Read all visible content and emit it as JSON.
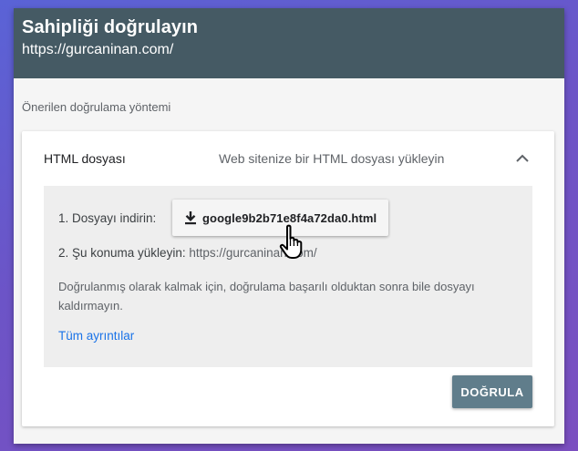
{
  "dialog": {
    "title": "Sahipliği doğrulayın",
    "subtitle": "https://gurcaninan.com/"
  },
  "recommended_label": "Önerilen doğrulama yöntemi",
  "method": {
    "title": "HTML dosyası",
    "description": "Web sitenize bir HTML dosyası yükleyin",
    "expanded_icon": "chevron-up-icon"
  },
  "steps": {
    "step1_label": "1. Dosyayı indirin:",
    "download_icon": "download-icon",
    "download_filename": "google9b2b71e8f4a72da0.html",
    "step2_label": "2. Şu konuma yükleyin:",
    "step2_url": "https://gurcaninan.com/"
  },
  "note": "Doğrulanmış olarak kalmak için, doğrulama başarılı olduktan sonra bile dosyayı kaldırmayın.",
  "details_link": "Tüm ayrıntılar",
  "verify_button": "DOĞRULA",
  "colors": {
    "header_bg": "#455a64",
    "verify_bg": "#607d8b",
    "link": "#1a73e8",
    "panel_bg": "#eeeeee"
  },
  "cursor_icon": "hand-pointer-icon"
}
